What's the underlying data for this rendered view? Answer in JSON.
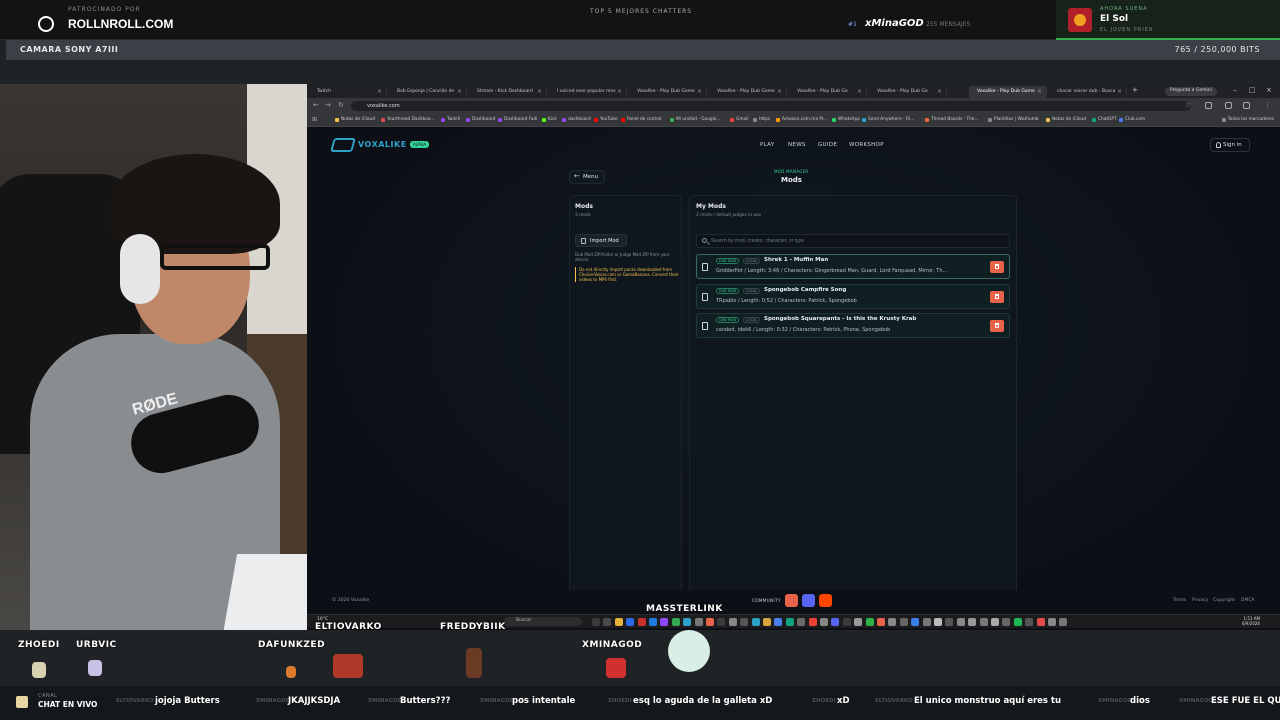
{
  "overlay": {
    "sponsor_label": "PATROCINADO POR",
    "sponsor_domain": "ROLLNROLL.COM",
    "top_chatters_title": "TOP 5 MEJORES CHATTERS",
    "top_chatter_rank": "#1",
    "top_chatter_name": "xMinaGOD",
    "top_chatter_count": "255 MENSAJES",
    "now_playing_label": "AHORA SUENA",
    "now_playing_title": "El Sol",
    "now_playing_artist": "EL JOVEN PRIER",
    "camera_label": "CAMARA SONY A7III",
    "bits_goal": "765 / 250,000 BITS",
    "bits_goal_fraction": 0.003
  },
  "browser": {
    "tabs": [
      {
        "label": "Twitch"
      },
      {
        "label": "Bob Esponja | Canción de"
      },
      {
        "label": "Stream - Kick Dashboard"
      },
      {
        "label": "I voiced over popular mov"
      },
      {
        "label": "Voxalike - Play Dub Game"
      },
      {
        "label": "Voxalike - Play Dub Game"
      },
      {
        "label": "Voxalike - Play Dub Ga"
      },
      {
        "label": "Voxalike - Play Dub Ga"
      },
      {
        "label": "Voxalike - Play Dub Game"
      },
      {
        "label": "chocar voicer dub - Busca"
      }
    ],
    "active_tab_index": 8,
    "gemini_button": "Pregunta a Gemini",
    "url": "voxalike.com",
    "bookmarks": [
      {
        "label": "Notas de iCloud",
        "color": "#f2c14e"
      },
      {
        "label": "Yourthread Dashboa...",
        "color": "#e34b4b"
      },
      {
        "label": "Twitch",
        "color": "#9146ff"
      },
      {
        "label": "Dashboard",
        "color": "#9146ff"
      },
      {
        "label": "Dashboard Fadi",
        "color": "#9146ff"
      },
      {
        "label": "Kick",
        "color": "#53fc18"
      },
      {
        "label": "dashboard",
        "color": "#9146ff"
      },
      {
        "label": "YouTube",
        "color": "#ff0000"
      },
      {
        "label": "Panel de control",
        "color": "#ff0000"
      },
      {
        "label": "Mi unidad - Google...",
        "color": "#34a853"
      },
      {
        "label": "Gmail",
        "color": "#ea4335"
      },
      {
        "label": "https",
        "color": "#888888"
      },
      {
        "label": "Amazon.com.mx Pr...",
        "color": "#ff9900"
      },
      {
        "label": "WhatsApp",
        "color": "#25d366"
      },
      {
        "label": "Send Anywhere - Fil...",
        "color": "#2ea1c8"
      },
      {
        "label": "Thread Boards - The...",
        "color": "#e86a4a"
      },
      {
        "label": "Plantillas | Washumb",
        "color": "#888888"
      },
      {
        "label": "Notas de iCloud",
        "color": "#f2c14e"
      },
      {
        "label": "ChatGPT",
        "color": "#10a37f"
      },
      {
        "label": "Club.com",
        "color": "#4a7ee8"
      },
      {
        "label": "Todos los marcadores",
        "color": "#888888"
      }
    ]
  },
  "site": {
    "logo_text": "VOXALIKE",
    "logo_badge": "ALPHA",
    "nav": [
      "PLAY",
      "NEWS",
      "GUIDE",
      "WORKSHOP"
    ],
    "signin_label": "Sign in",
    "menu_label": "Menu",
    "overline": "MOD MANAGER",
    "page_title": "Mods",
    "left_panel": {
      "title": "Mods",
      "count": "3 mods",
      "import_label": "Import Mod",
      "help": "Dub Mod ZIP/folder or Judge Mod ZIP from your device.",
      "warning": "Do not directly import packs downloaded from ChoicerVoicer.com or GameBanana. Convert their videos to MP4 first."
    },
    "right_panel": {
      "title": "My Mods",
      "subtitle": "3 mods / default judges in use",
      "search_placeholder": "Search by mod, creator, character, or type",
      "mods": [
        {
          "badge": "DUB MOD",
          "tag": "LOCAL",
          "title": "Shrek 1 - Muffin Man",
          "meta": "GridderPot / Length: 3:46 / Characters: Gingerbread Man, Guard, Lord Farquaad, Mirror, Th..."
        },
        {
          "badge": "DUB MOD",
          "tag": "LOCAL",
          "title": "Spongebob Campfire Song",
          "meta": "TRpablo / Length: 0:52 / Characters: Patrick, Spongebob"
        },
        {
          "badge": "DUB MOD",
          "tag": "LOCAL",
          "title": "Spongebob Squarepants - Is this the Krusty Krab",
          "meta": "canded, idek6 / Length: 0:32 / Characters: Patrick, Phone, Spongebob"
        }
      ]
    },
    "footer": {
      "copyright": "© 2026 Voxalike",
      "community_label": "COMMUNITY",
      "links": [
        "Terms",
        "Privacy",
        "Copyright",
        "DMCA"
      ]
    }
  },
  "taskbar": {
    "weather": "16°C",
    "search_placeholder": "Buscar",
    "time": "1:51 AM",
    "date": "6/9/2026"
  },
  "alerts": {
    "viewers": [
      "ZHOEDI",
      "URBVIC",
      "DAFUNKZED",
      "ELTIOVARKO",
      "FREDDYBIIK",
      "MASSTERLINK",
      "XMINAGOD"
    ]
  },
  "ticker": {
    "channel_label": "CANAL",
    "live_label": "CHAT EN VIVO",
    "messages": [
      {
        "user": "ELTIOVARKO",
        "text": "jojoja Butters"
      },
      {
        "user": "XMINAGOD",
        "text": "JKAJJKSDJA"
      },
      {
        "user": "XMINAGOD",
        "text": "Butters???"
      },
      {
        "user": "XMINAGOD",
        "text": "pos intentale"
      },
      {
        "user": "ZHOEDI",
        "text": "esq lo aguda de la galleta xD"
      },
      {
        "user": "ZHOEDI",
        "text": "xD"
      },
      {
        "user": "ELTIOVARKO",
        "text": "El unico monstruo aquí eres tu"
      },
      {
        "user": "XMINAGOD",
        "text": "dios"
      },
      {
        "user": "XMINAGOD",
        "text": "ESE FUE EL QUE VI AJKSDJ"
      }
    ]
  },
  "colors": {
    "accent": "#2ea1c8",
    "success": "#34d399",
    "danger": "#e8634a",
    "warning": "#f2c14e"
  }
}
